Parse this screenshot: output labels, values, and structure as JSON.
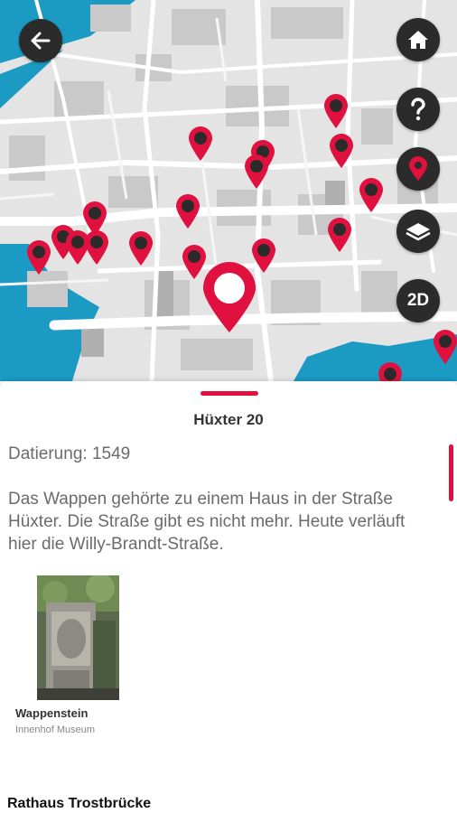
{
  "map": {
    "controls": [
      {
        "name": "home-button",
        "icon": "home-icon"
      },
      {
        "name": "help-button",
        "icon": "question-icon"
      },
      {
        "name": "location-button",
        "icon": "location-pin-icon"
      },
      {
        "name": "layers-button",
        "icon": "layers-icon"
      },
      {
        "name": "view-toggle-button",
        "icon": "2d-icon",
        "label": "2D"
      }
    ],
    "accent": "#e0103f",
    "water": "#1b9bc4"
  },
  "detail": {
    "title": "Hüxter 20",
    "dating": "Datierung: 1549",
    "description": "Das Wappen gehörte zu einem Haus in der Straße Hüxter. Die Straße gibt es nicht mehr. Heute verläuft hier die Willy-Brandt-Straße.",
    "card": {
      "title": "Wappenstein",
      "subtitle": "Innenhof Museum"
    },
    "next_title": "Rathaus Trostbrücke"
  }
}
